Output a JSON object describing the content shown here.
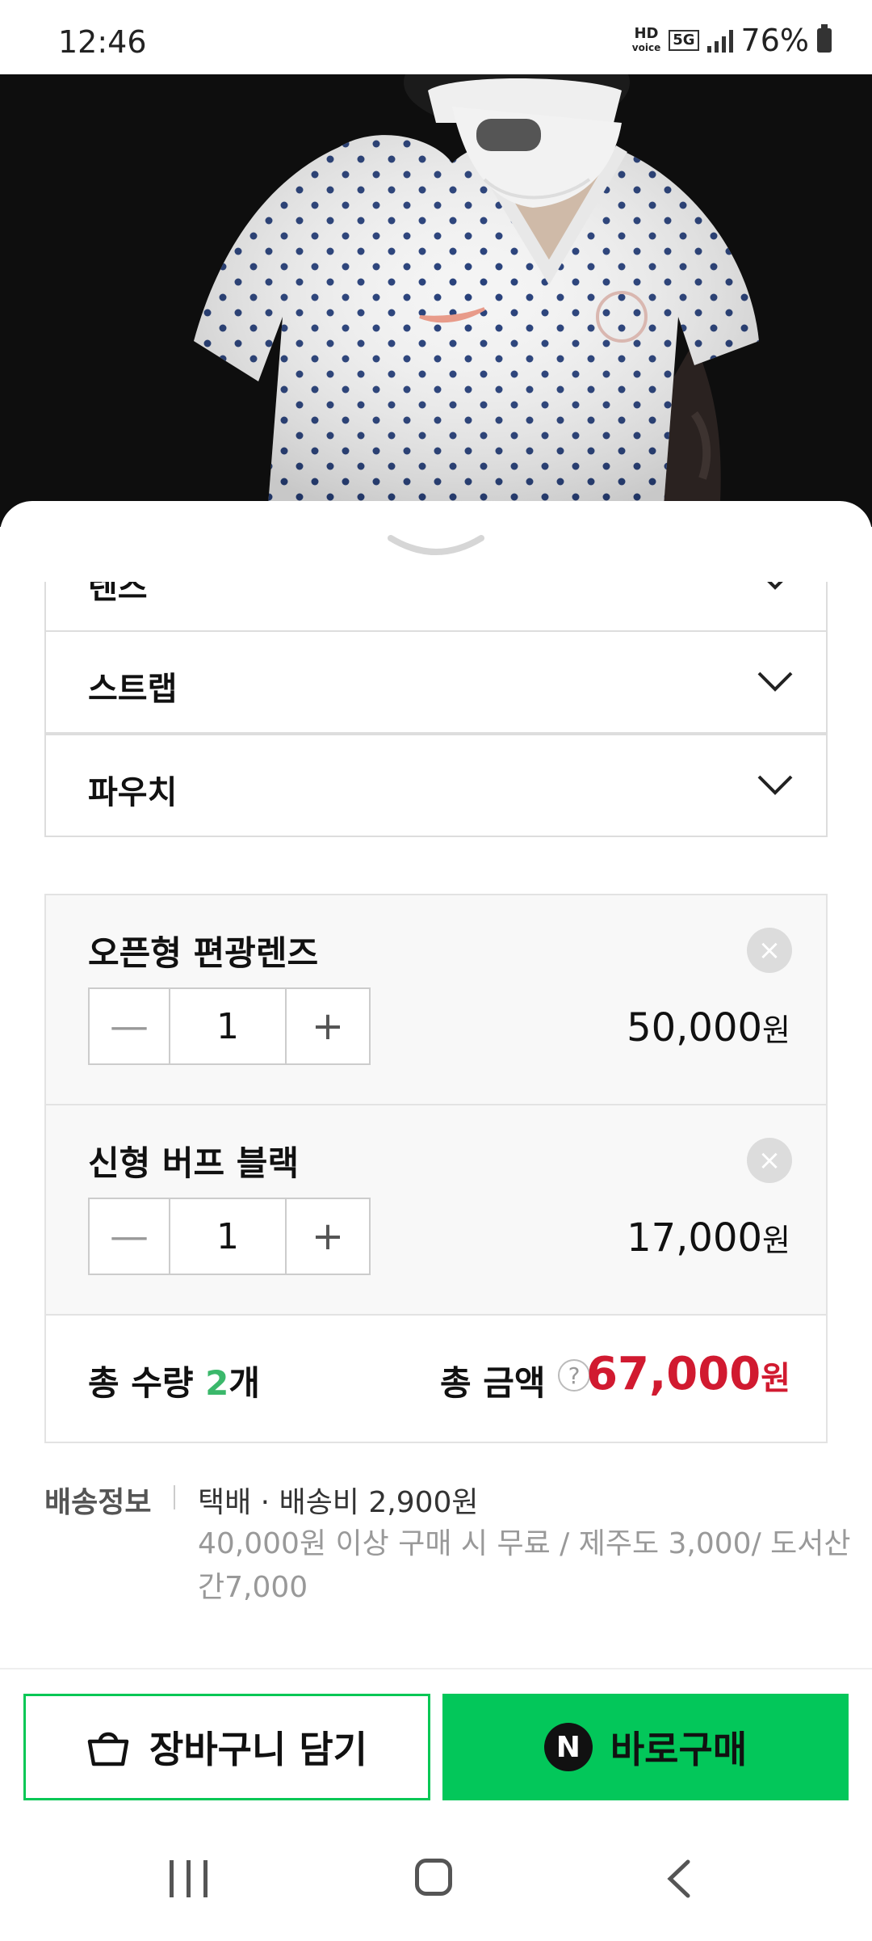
{
  "status_bar": {
    "time": "12:46",
    "hd_label": "HD\nvoice",
    "network": "5G",
    "battery": "76%"
  },
  "options": [
    {
      "label": "렌즈"
    },
    {
      "label": "스트랩"
    },
    {
      "label": "파우치"
    }
  ],
  "selected_items": [
    {
      "name": "오픈형 편광렌즈",
      "quantity": "1",
      "price": "50,000",
      "currency": "원"
    },
    {
      "name": "신형 버프 블랙",
      "quantity": "1",
      "price": "17,000",
      "currency": "원"
    }
  ],
  "stepper": {
    "minus": "—",
    "plus": "+"
  },
  "remove_symbol": "×",
  "total": {
    "quantity_label": "총 수량",
    "quantity_value": "2",
    "quantity_unit": "개",
    "amount_label": "총 금액",
    "help_symbol": "?",
    "amount": "67,000",
    "currency": "원"
  },
  "shipping": {
    "label": "배송정보",
    "line1": "택배 · 배송비 2,900원",
    "line2": "40,000원 이상 구매 시 무료 / 제주도 3,000/ 도서산간7,000"
  },
  "buttons": {
    "cart": "장바구니 담기",
    "buy": "바로구매",
    "npay_letter": "N"
  },
  "colors": {
    "accent_green": "#03c75a",
    "price_red": "#d11a30",
    "qty_green": "#3bb86b"
  }
}
